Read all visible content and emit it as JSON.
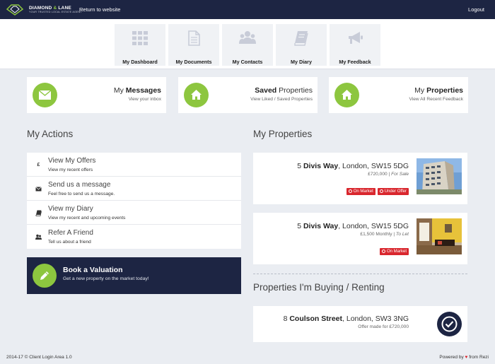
{
  "brand": {
    "name_part1": "DIAMOND",
    "name_amp": "&",
    "name_part2": "LANE",
    "tagline": "YOUR TRUSTED LOCAL ESTATE AGENT",
    "accent_color": "#8dc63f",
    "navy_color": "#1d2543"
  },
  "topbar": {
    "return_label": "Return to website",
    "logout_label": "Logout"
  },
  "nav": [
    {
      "label": "My Dashboard",
      "icon": "grid-icon"
    },
    {
      "label": "My Documents",
      "icon": "document-icon"
    },
    {
      "label": "My Contacts",
      "icon": "contacts-icon"
    },
    {
      "label": "My Diary",
      "icon": "book-icon"
    },
    {
      "label": "My Feedback",
      "icon": "megaphone-icon"
    }
  ],
  "summary": [
    {
      "prefix": "My",
      "strong": "Messages",
      "suffix": "",
      "sub": "View your inbox",
      "icon": "envelope-icon"
    },
    {
      "prefix": "",
      "strong": "Saved",
      "suffix": "Properties",
      "sub": "View Liked / Saved Properties",
      "icon": "home-icon"
    },
    {
      "prefix": "My",
      "strong": "Properties",
      "suffix": "",
      "sub": "View All Recent Feedback",
      "icon": "home-icon"
    }
  ],
  "actions": {
    "title": "My Actions",
    "items": [
      {
        "title": "View My Offers",
        "sub": "View my recent offers",
        "icon": "pound-icon",
        "glyph": "£"
      },
      {
        "title": "Send us a message",
        "sub": "Feel free to send us a message.",
        "icon": "envelope-icon",
        "glyph": ""
      },
      {
        "title": "View my Diary",
        "sub": "View my recent and upcoming events",
        "icon": "book-icon",
        "glyph": ""
      },
      {
        "title": "Refer A Friend",
        "sub": "Tell us about a friend",
        "icon": "users-icon",
        "glyph": ""
      }
    ]
  },
  "valuation": {
    "title": "Book a Valuation",
    "sub": "Get a new property on the market today!",
    "icon": "pencil-icon"
  },
  "properties": {
    "title": "My Properties",
    "items": [
      {
        "number": "5",
        "street": "Divis Way",
        "rest": ", London, SW15 5DG",
        "price": "£720,000",
        "status": "For Sale",
        "badges": [
          "On Market",
          "Under Offer"
        ]
      },
      {
        "number": "5",
        "street": "Divis Way",
        "rest": ", London, SW15 5DG",
        "price": "£1,500 Monthly",
        "status": "To Let",
        "badges": [
          "On Market"
        ]
      }
    ]
  },
  "buying": {
    "title": "Properties I'm Buying / Renting",
    "items": [
      {
        "number": "8",
        "street": "Coulson Street",
        "rest": ", London, SW3 3NG",
        "offer": "Offer made for £720,000",
        "icon": "check-circle-icon"
      }
    ]
  },
  "footer": {
    "left": "2014-17 © Client Login Area 1.0",
    "right_prefix": "Powered by",
    "right_suffix": "from Rezi"
  }
}
